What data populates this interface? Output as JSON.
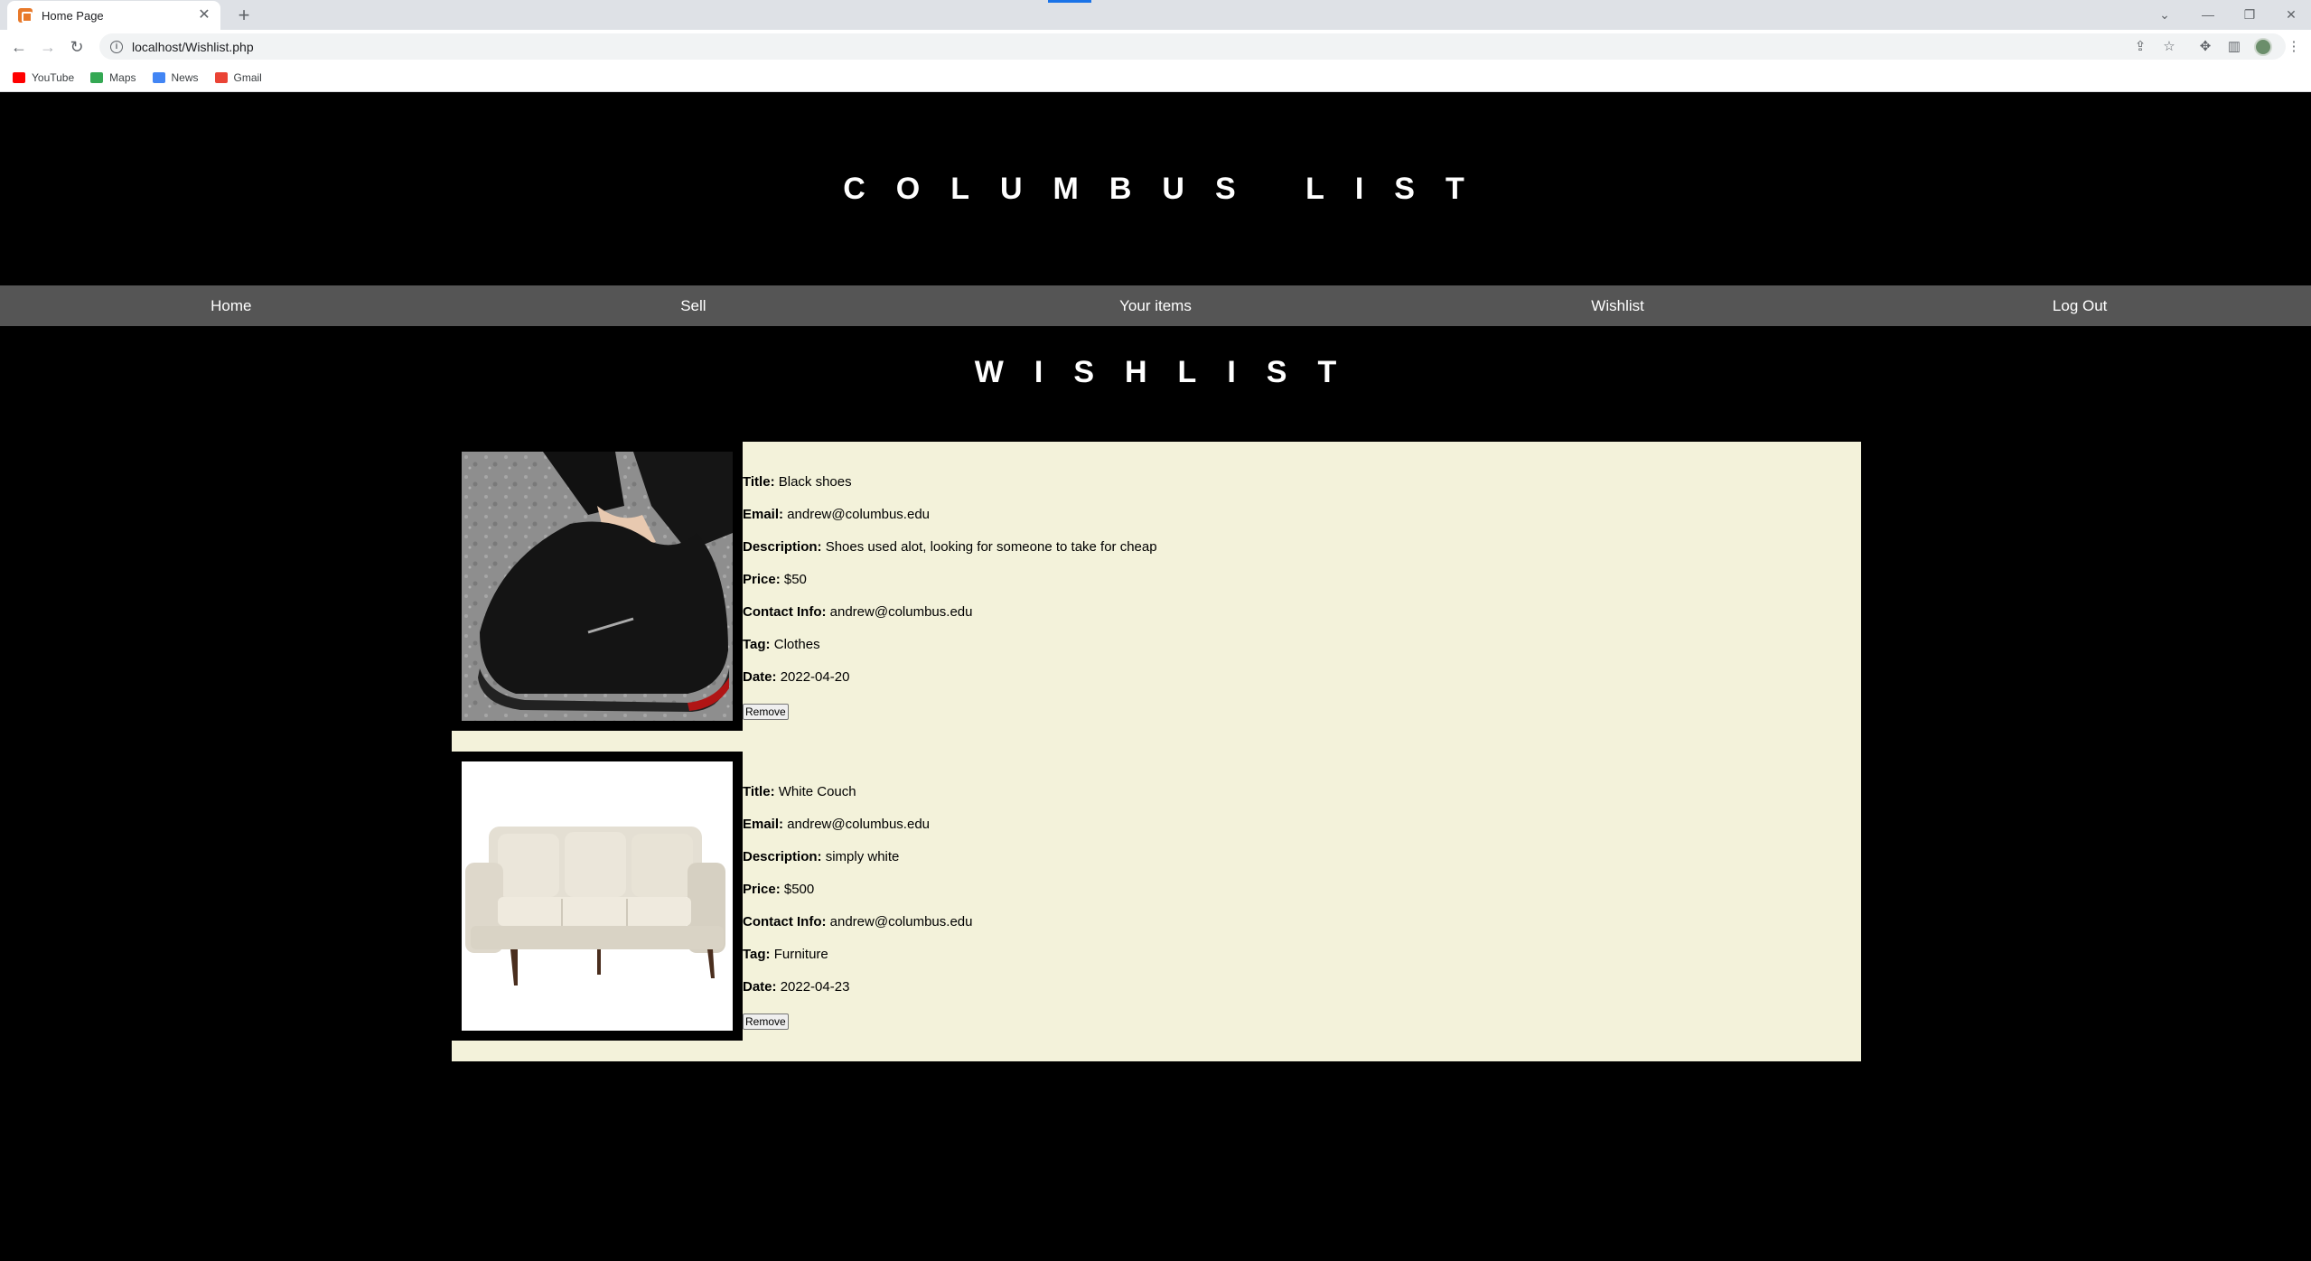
{
  "browser": {
    "tab_title": "Home Page",
    "url": "localhost/Wishlist.php",
    "bookmarks": [
      {
        "label": "YouTube",
        "color": "#ff0000"
      },
      {
        "label": "Maps",
        "color": "#34a853"
      },
      {
        "label": "News",
        "color": "#4285f4"
      },
      {
        "label": "Gmail",
        "color": "#ea4335"
      }
    ]
  },
  "site": {
    "title": "COLUMBUS LIST",
    "nav": [
      "Home",
      "Sell",
      "Your items",
      "Wishlist",
      "Log Out"
    ],
    "section_title": "WISHLIST"
  },
  "labels": {
    "title": "Title:",
    "email": "Email:",
    "description": "Description:",
    "price": "Price:",
    "contact": "Contact Info:",
    "tag": "Tag:",
    "date": "Date:",
    "remove": "Remove"
  },
  "items": [
    {
      "image": "black-shoes-photo",
      "title": "Black shoes",
      "email": "andrew@columbus.edu",
      "description": "Shoes used alot, looking for someone to take for cheap",
      "price": "$50",
      "contact": "andrew@columbus.edu",
      "tag": "Clothes",
      "date": "2022-04-20"
    },
    {
      "image": "white-couch-photo",
      "title": "White Couch",
      "email": "andrew@columbus.edu",
      "description": "simply white",
      "price": "$500",
      "contact": "andrew@columbus.edu",
      "tag": "Furniture",
      "date": "2022-04-23"
    }
  ]
}
